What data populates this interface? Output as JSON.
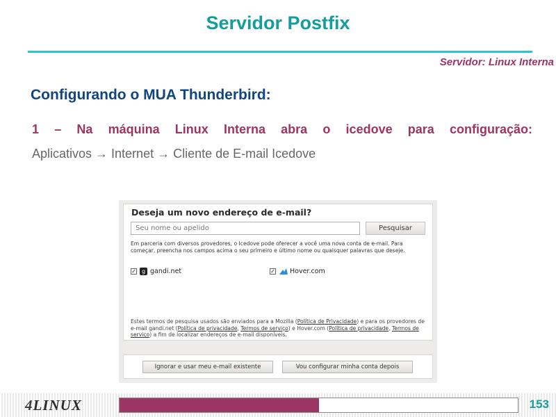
{
  "slide": {
    "title": "Servidor Postfix",
    "subtitle": "Servidor: Linux Interna",
    "section": "Configurando o MUA Thunderbird:",
    "step": "1 – Na máquina Linux Interna abra o icedove para configuração:",
    "path": "Aplicativos → Internet → Cliente de E-mail Icedove"
  },
  "dialog": {
    "title": "Deseja um novo endereço de e-mail?",
    "search_placeholder": "Seu nome ou apelido",
    "search_button": "Pesquisar",
    "intro": "Em parceria com diversos provedores, o Icedove pode oferecer a você uma nova conta de e-mail. Para começar, preencha nos campos acima o seu primeiro e último nome ou quaisquer palavras que deseje.",
    "providers": [
      {
        "name": "gandi.net",
        "checked": true,
        "icon": "gandi-logo-icon"
      },
      {
        "name": "Hover.com",
        "checked": true,
        "icon": "hover-logo-icon"
      }
    ],
    "terms": {
      "t1": "Estes termos de pesquisa usados são enviados para a Mozilla (",
      "l1": "Política de Privacidade",
      "t2": ") e para os provedores de e-mail gandi.net (",
      "l2": "Política de privacidade",
      "t3": ", ",
      "l3": "Termos de serviço",
      "t4": ") e Hover.com (",
      "l4": "Política de privacidade",
      "t5": ", ",
      "l5": "Termos de serviço",
      "t6": ") a fim de localizar endereços de e-mail disponíveis."
    },
    "skip_button": "Ignorar e usar meu e-mail existente",
    "later_button": "Vou configurar minha conta depois"
  },
  "footer": {
    "logo_number": "4",
    "logo_text": "LINUX",
    "progress": 0.5,
    "progress_color": "#9c3464",
    "page": "153"
  },
  "colors": {
    "title": "#169c9c",
    "accent": "#9c3464",
    "section": "#10457e"
  }
}
